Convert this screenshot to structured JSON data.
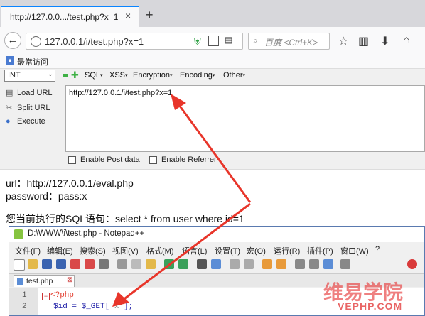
{
  "browser": {
    "tab_title": "http://127.0.0.../test.php?x=1",
    "tab_close": "×",
    "new_tab": "+",
    "url": "127.0.0.1/i/test.php?x=1",
    "search_placeholder": "百度 <Ctrl+K>",
    "bookmark_label": "最常访问"
  },
  "hackbar": {
    "select_value": "INT",
    "menus": [
      "SQL",
      "XSS",
      "Encryption",
      "Encoding",
      "Other"
    ],
    "actions": [
      "Load URL",
      "Split URL",
      "Execute"
    ],
    "url_value": "http://127.0.0.1/i/test.php?x=1",
    "enable_post": "Enable Post data",
    "enable_referrer": "Enable Referrer"
  },
  "content": {
    "url_line": "url：http://127.0.0.1/eval.php",
    "password_line": "password：pass:x",
    "sql_line": "您当前执行的SQL语句：select * from user where id=1"
  },
  "notepad": {
    "title": "D:\\WWW\\i\\test.php - Notepad++",
    "menus": [
      "文件(F)",
      "编辑(E)",
      "搜索(S)",
      "视图(V)",
      "格式(M)",
      "语言(L)",
      "设置(T)",
      "宏(O)",
      "运行(R)",
      "插件(P)",
      "窗口(W)",
      "?"
    ],
    "tab_name": "test.php",
    "code_lines": [
      {
        "num": "1",
        "text": "<?php"
      },
      {
        "num": "2",
        "text_prefix": "$id = $_GET[",
        "text_string": "'x'",
        "text_suffix": "];"
      }
    ]
  },
  "watermark": {
    "cn": "维易学院",
    "en": "VEPHP.COM"
  },
  "colors": {
    "arrow": "#e8352a",
    "tab_accent": "#0a84ff",
    "php_tag": "#e34234",
    "string": "#808080"
  }
}
